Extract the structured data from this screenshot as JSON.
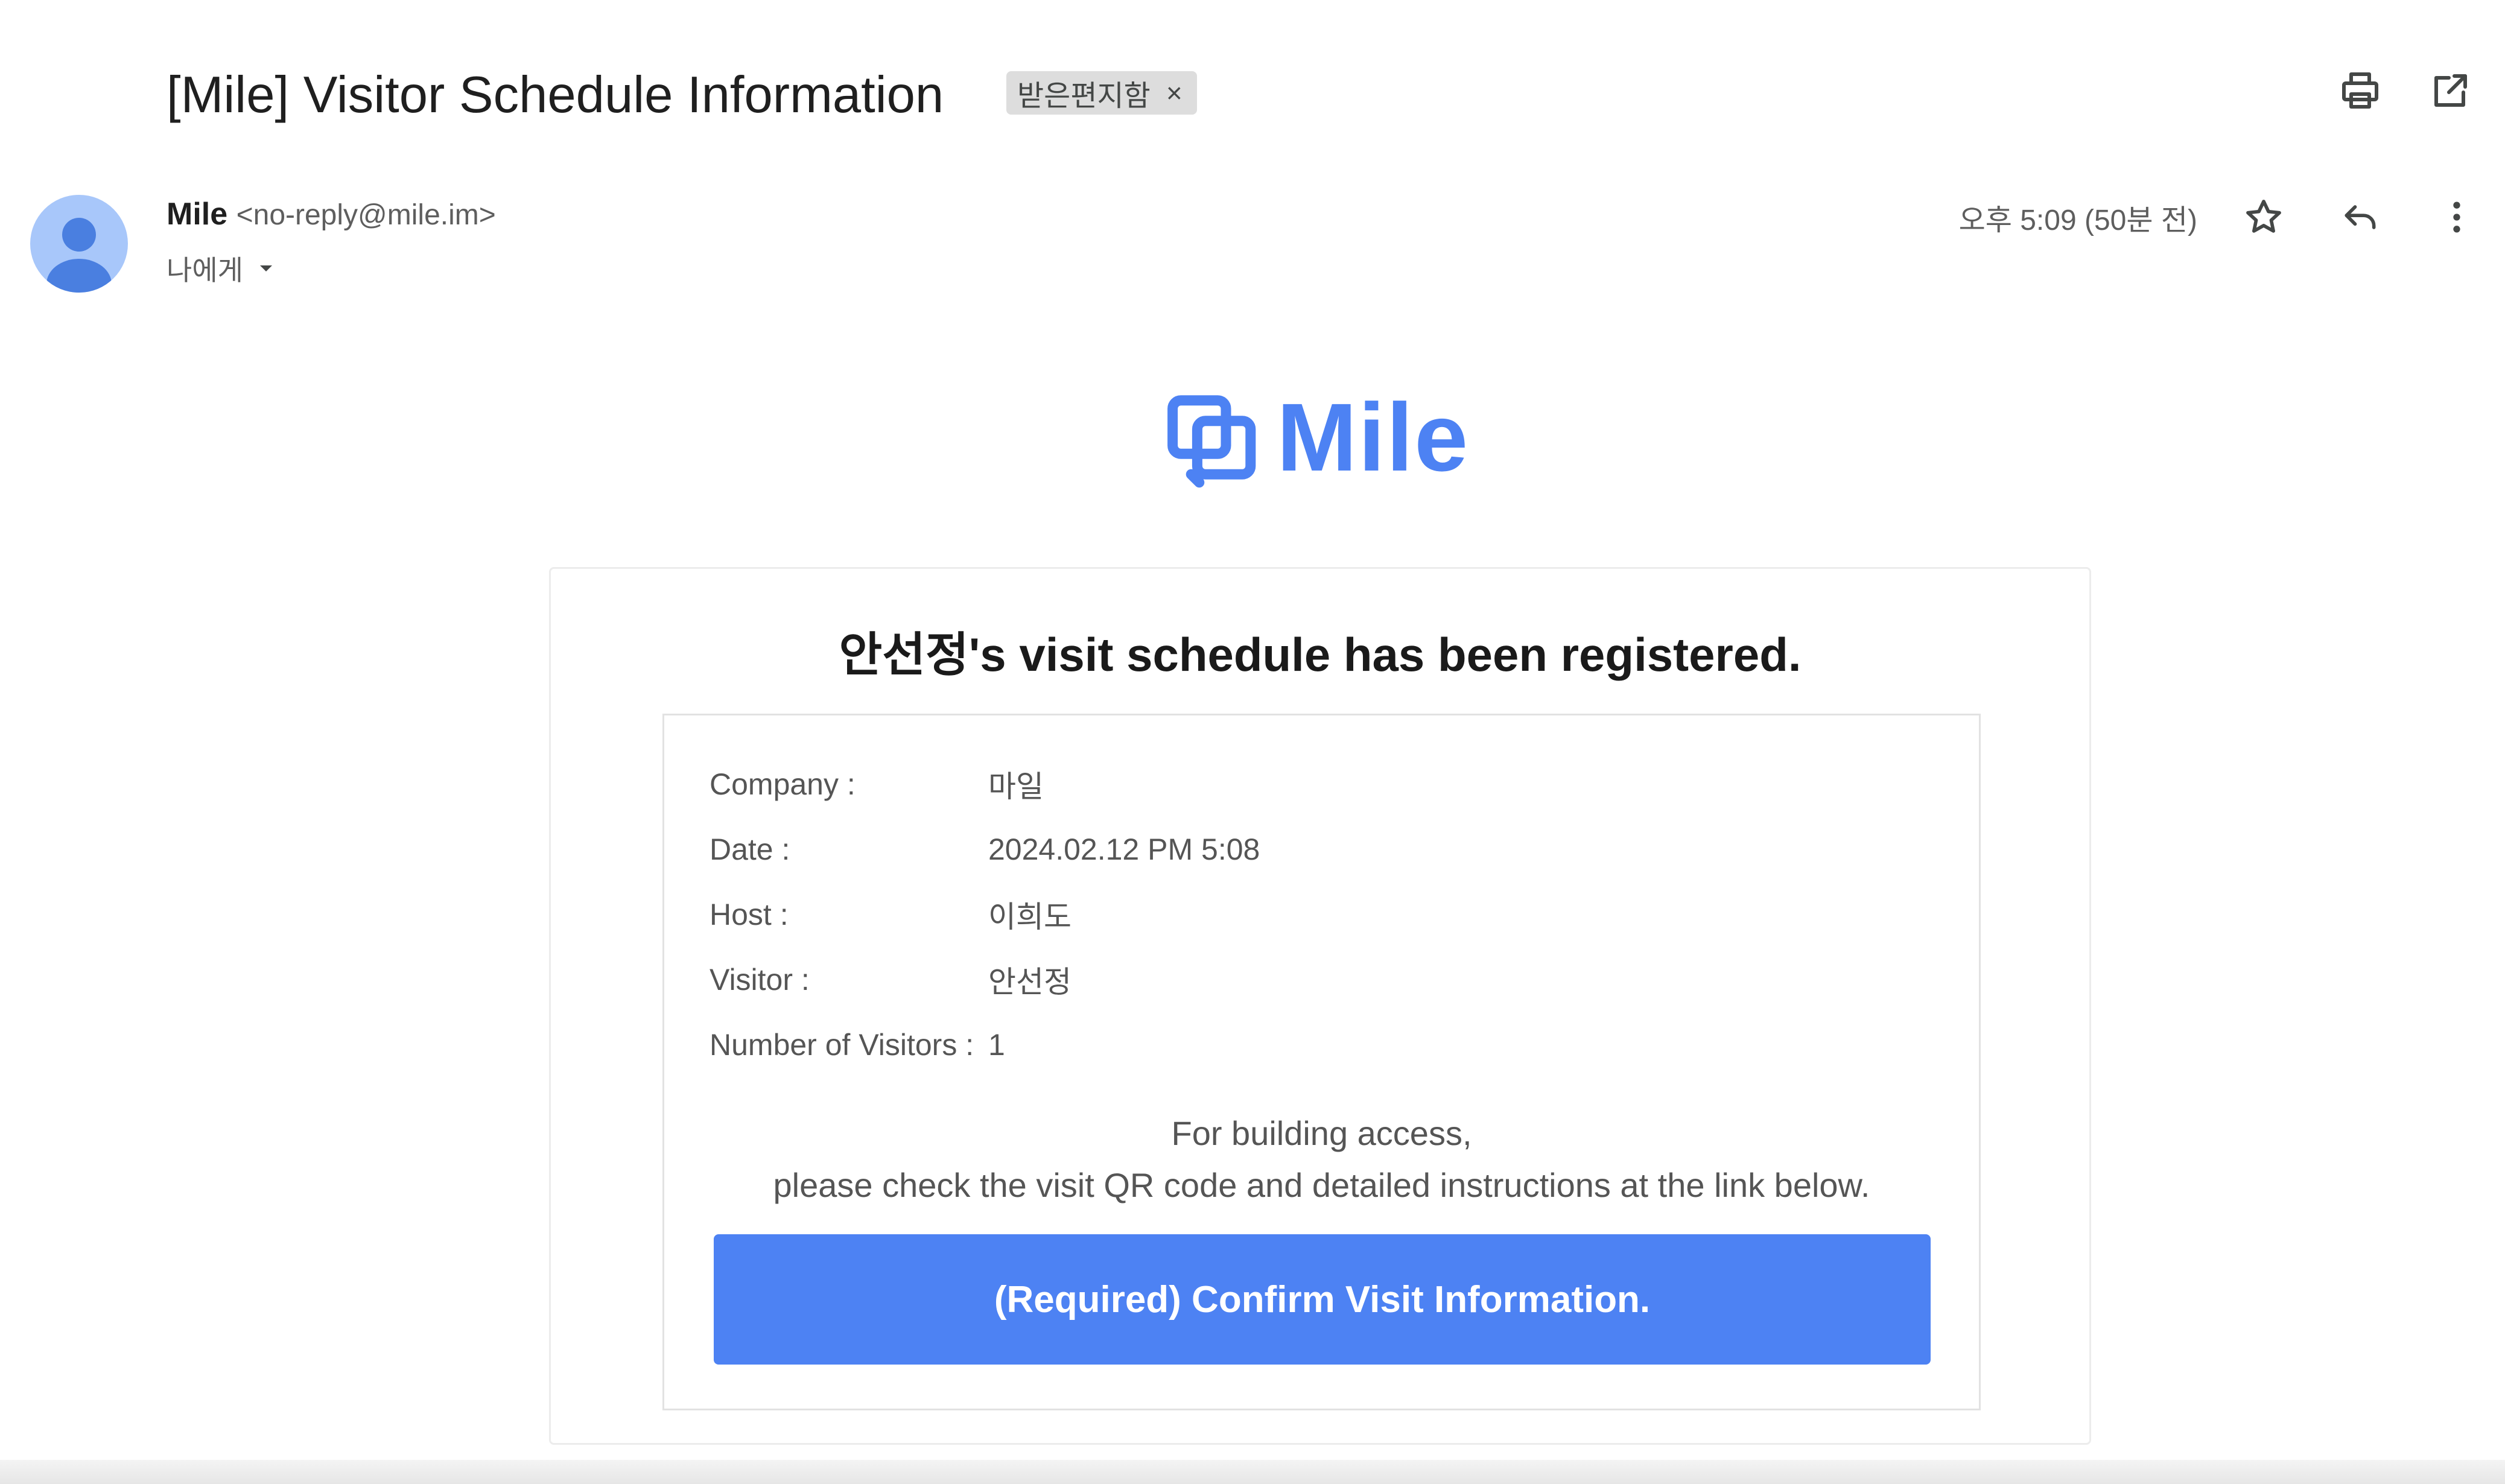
{
  "email": {
    "subject": "[Mile] Visitor Schedule Information",
    "label_chip": "받은편지함",
    "label_remove": "×",
    "sender_name": "Mile",
    "sender_email": "<no-reply@mile.im>",
    "recipient": "나에게",
    "timestamp": "오후 5:09 (50분 전)"
  },
  "icons": {
    "print": "print-icon",
    "open_new_window": "open-in-new-window-icon",
    "star": "star-icon",
    "reply": "reply-icon",
    "more": "more-vertical-icon",
    "recipient_dropdown": "caret-down-icon",
    "avatar": "person-avatar-icon"
  },
  "body": {
    "logo_text": "Mile",
    "headline": "안선정's visit schedule has been registered.",
    "details": [
      {
        "label": "Company :",
        "value": "마일"
      },
      {
        "label": "Date :",
        "value": "2024.02.12 PM 5:08"
      },
      {
        "label": "Host :",
        "value": "이희도"
      },
      {
        "label": "Visitor :",
        "value": "안선정"
      },
      {
        "label": "Number of Visitors :",
        "value": "1"
      }
    ],
    "note_line1": "For building access,",
    "note_line2": "please check the visit QR code and detailed instructions at the link below.",
    "cta_label": "(Required) Confirm Visit Information."
  },
  "colors": {
    "brand_blue": "#4d82f3",
    "avatar_bg": "#a8c7fa",
    "avatar_fg": "#4a7fe0",
    "chip_bg": "#dddddd"
  }
}
